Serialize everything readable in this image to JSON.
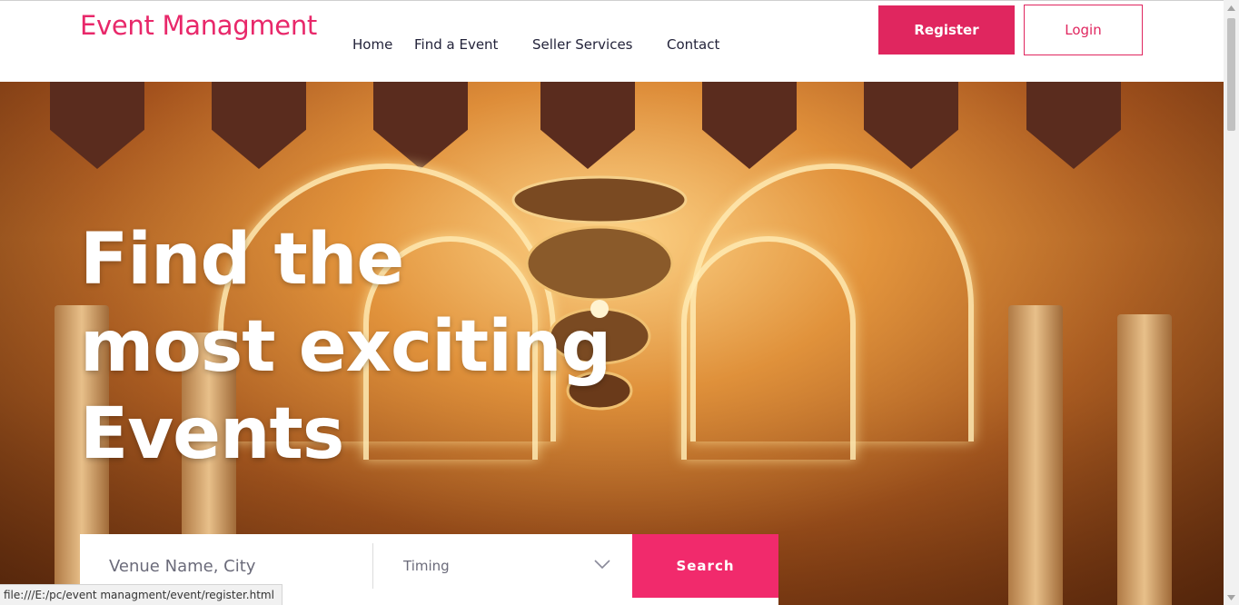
{
  "brand": {
    "logo_text": "Event Managment",
    "accent_color": "#e0265f"
  },
  "nav": {
    "items": [
      {
        "label": "Home"
      },
      {
        "label": "Find a Event"
      },
      {
        "label": "Seller Services"
      },
      {
        "label": "Contact"
      }
    ]
  },
  "auth": {
    "register_label": "Register",
    "login_label": "Login"
  },
  "hero": {
    "title_lines": [
      "Find the",
      "most exciting",
      "Events"
    ]
  },
  "search": {
    "venue_placeholder": "Venue Name, City",
    "timing_selected": "Timing",
    "search_label": "Search"
  },
  "status": {
    "link_url": "file:///E:/pc/event managment/event/register.html"
  }
}
